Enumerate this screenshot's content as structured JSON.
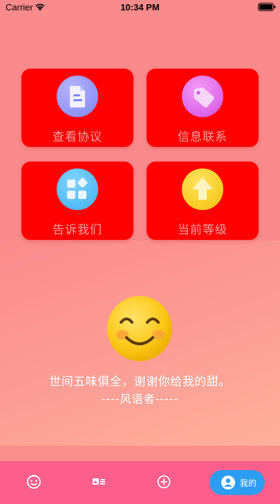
{
  "status_bar": {
    "carrier": "Carrier",
    "time": "10:34 PM"
  },
  "menu": {
    "items": [
      {
        "label": "查看协议",
        "icon": "document-icon"
      },
      {
        "label": "信息联系",
        "icon": "tag-icon"
      },
      {
        "label": "告诉我们",
        "icon": "apps-icon"
      },
      {
        "label": "当前等级",
        "icon": "arrow-up-icon"
      }
    ]
  },
  "quote": {
    "line1": "世间五味俱全，谢谢你给我的甜。",
    "line2": "----风语者-----"
  },
  "tab_bar": {
    "tabs": [
      {
        "icon": "face-icon"
      },
      {
        "icon": "gallery-icon"
      },
      {
        "icon": "add-circle-icon"
      },
      {
        "icon": "user-icon",
        "label": "我的",
        "active": true
      }
    ]
  },
  "colors": {
    "background": "#fb8a8c",
    "card": "#ff0000",
    "card_label": "#f3a1a1",
    "tab_bar": "#fd5f8c",
    "active_tab": "#2c9df0"
  }
}
